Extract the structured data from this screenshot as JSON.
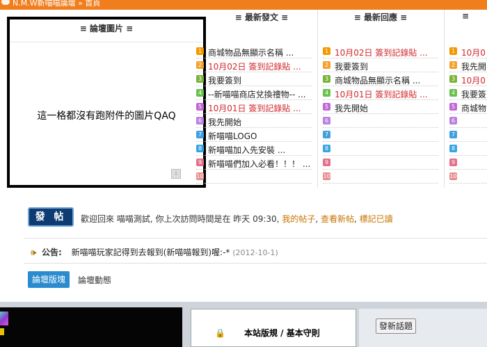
{
  "header": {
    "breadcrumb": "N.M.W新喵喵論壇 » 首頁"
  },
  "columns": {
    "pictures": {
      "title": "≡ 論壇圖片 ≡",
      "placeholder_text": "這一格都沒有跑附件的圖片QAQ"
    },
    "new_posts": {
      "title": "≡ 最新發文 ≡",
      "items": [
        {
          "num": "1",
          "text": "商城物品無顯示名稱 ...",
          "red": false
        },
        {
          "num": "2",
          "text": "10月02日 簽到記錄貼 ...",
          "red": true
        },
        {
          "num": "3",
          "text": "我要簽到",
          "red": false
        },
        {
          "num": "4",
          "text": "--新喵喵商店兌換禮物-- ...",
          "red": false
        },
        {
          "num": "5",
          "text": "10月01日 簽到記錄貼 ...",
          "red": true
        },
        {
          "num": "6",
          "text": "我先開始",
          "red": false
        },
        {
          "num": "7",
          "text": "新喵喵LOGO",
          "red": false
        },
        {
          "num": "8",
          "text": "新喵喵加入先安裝 ...",
          "red": false
        },
        {
          "num": "9",
          "text": "新喵喵們加入必看！！！ ...",
          "red": false
        },
        {
          "num": "10",
          "text": "",
          "red": false
        }
      ]
    },
    "new_replies": {
      "title": "≡ 最新回應 ≡",
      "items": [
        {
          "num": "1",
          "text": "10月02日 簽到記錄貼 ...",
          "red": true
        },
        {
          "num": "2",
          "text": "我要簽到",
          "red": false
        },
        {
          "num": "3",
          "text": "商城物品無顯示名稱 ...",
          "red": false
        },
        {
          "num": "4",
          "text": "10月01日 簽到記錄貼 ...",
          "red": true
        },
        {
          "num": "5",
          "text": "我先開始",
          "red": false
        },
        {
          "num": "6",
          "text": "",
          "red": false
        },
        {
          "num": "7",
          "text": "",
          "red": false
        },
        {
          "num": "8",
          "text": "",
          "red": false
        },
        {
          "num": "9",
          "text": "",
          "red": false
        },
        {
          "num": "10",
          "text": "",
          "red": false
        }
      ]
    },
    "fourth": {
      "title": "≡",
      "items": [
        {
          "num": "1",
          "text": "10月0",
          "red": true
        },
        {
          "num": "2",
          "text": "我先開",
          "red": false
        },
        {
          "num": "3",
          "text": "10月0",
          "red": true
        },
        {
          "num": "4",
          "text": "我要簽",
          "red": false
        },
        {
          "num": "5",
          "text": "商城物",
          "red": false
        },
        {
          "num": "6",
          "text": "",
          "red": false
        },
        {
          "num": "7",
          "text": "",
          "red": false
        },
        {
          "num": "8",
          "text": "",
          "red": false
        },
        {
          "num": "9",
          "text": "",
          "red": false
        },
        {
          "num": "10",
          "text": "",
          "red": false
        }
      ]
    }
  },
  "post_button": "發 帖",
  "welcome": {
    "text": "歡迎回來 喵喵測試, 你上次訪問時間是在 昨天 09:30,",
    "my_posts": "我的帖子",
    "view_new": "查看新帖",
    "mark_read": "標記已讀"
  },
  "notice": {
    "label": "公告:",
    "text": "新喵喵玩家記得到去報到(新喵喵報到)喔:-*",
    "date": "(2012-10-1)"
  },
  "tabs": {
    "active": "論壇版塊",
    "other": "論壇動態"
  },
  "bottom": {
    "rules": "本站版規 / 基本守則",
    "new_topic": "發新話題"
  },
  "icons": {
    "chat": "chat-bubble-icon",
    "speaker": "speaker-icon",
    "lock": "lock-icon"
  }
}
